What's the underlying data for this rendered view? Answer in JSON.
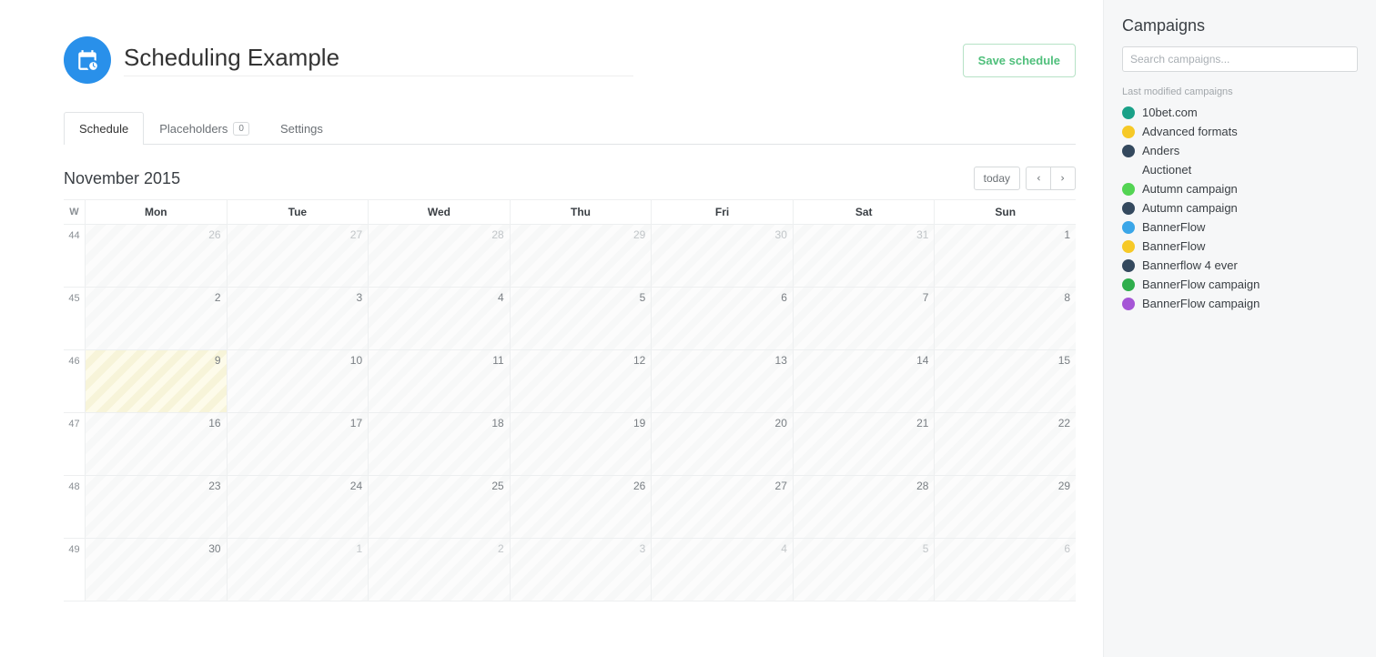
{
  "header": {
    "title": "Scheduling Example",
    "save_label": "Save schedule"
  },
  "tabs": {
    "schedule": "Schedule",
    "placeholders": "Placeholders",
    "placeholders_count": "0",
    "settings": "Settings"
  },
  "calendar": {
    "title": "November 2015",
    "today_label": "today",
    "week_header": "W",
    "days": [
      "Mon",
      "Tue",
      "Wed",
      "Thu",
      "Fri",
      "Sat",
      "Sun"
    ],
    "weeks": [
      {
        "num": "44",
        "cells": [
          {
            "n": "26",
            "muted": true
          },
          {
            "n": "27",
            "muted": true
          },
          {
            "n": "28",
            "muted": true
          },
          {
            "n": "29",
            "muted": true
          },
          {
            "n": "30",
            "muted": true
          },
          {
            "n": "31",
            "muted": true
          },
          {
            "n": "1",
            "muted": false
          }
        ]
      },
      {
        "num": "45",
        "cells": [
          {
            "n": "2"
          },
          {
            "n": "3"
          },
          {
            "n": "4"
          },
          {
            "n": "5"
          },
          {
            "n": "6"
          },
          {
            "n": "7"
          },
          {
            "n": "8"
          }
        ]
      },
      {
        "num": "46",
        "cells": [
          {
            "n": "9",
            "today": true
          },
          {
            "n": "10"
          },
          {
            "n": "11"
          },
          {
            "n": "12"
          },
          {
            "n": "13"
          },
          {
            "n": "14"
          },
          {
            "n": "15"
          }
        ]
      },
      {
        "num": "47",
        "cells": [
          {
            "n": "16"
          },
          {
            "n": "17"
          },
          {
            "n": "18"
          },
          {
            "n": "19"
          },
          {
            "n": "20"
          },
          {
            "n": "21"
          },
          {
            "n": "22"
          }
        ]
      },
      {
        "num": "48",
        "cells": [
          {
            "n": "23"
          },
          {
            "n": "24"
          },
          {
            "n": "25"
          },
          {
            "n": "26"
          },
          {
            "n": "27"
          },
          {
            "n": "28"
          },
          {
            "n": "29"
          }
        ]
      },
      {
        "num": "49",
        "cells": [
          {
            "n": "30"
          },
          {
            "n": "1",
            "muted": true
          },
          {
            "n": "2",
            "muted": true
          },
          {
            "n": "3",
            "muted": true
          },
          {
            "n": "4",
            "muted": true
          },
          {
            "n": "5",
            "muted": true
          },
          {
            "n": "6",
            "muted": true
          }
        ]
      }
    ]
  },
  "sidebar": {
    "title": "Campaigns",
    "search_placeholder": "Search campaigns...",
    "subhead": "Last modified campaigns",
    "campaigns": [
      {
        "name": "10bet.com",
        "color": "#1aa188"
      },
      {
        "name": "Advanced formats",
        "color": "#f6c927"
      },
      {
        "name": "Anders",
        "color": "#34495e"
      },
      {
        "name": "Auctionet",
        "color": ""
      },
      {
        "name": "Autumn campaign",
        "color": "#53d453"
      },
      {
        "name": "Autumn campaign",
        "color": "#34495e"
      },
      {
        "name": "BannerFlow",
        "color": "#3aa6e8"
      },
      {
        "name": "BannerFlow",
        "color": "#f6c927"
      },
      {
        "name": "Bannerflow 4 ever",
        "color": "#34495e"
      },
      {
        "name": "BannerFlow campaign",
        "color": "#2fae4c"
      },
      {
        "name": "BannerFlow campaign",
        "color": "#a556d6"
      }
    ]
  }
}
